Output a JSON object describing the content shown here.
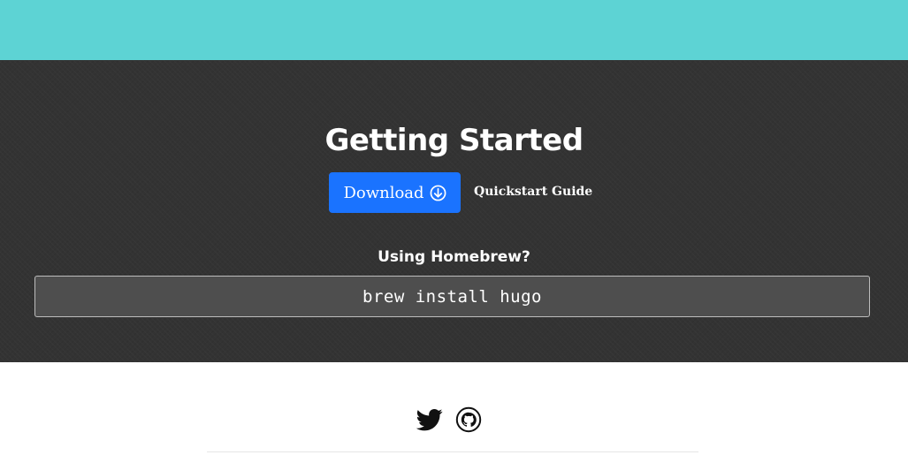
{
  "colors": {
    "top_band": "#5dd3d4",
    "dark_section": "#333333",
    "download_button": "#1a73ff",
    "code_box": "#4e4e4e"
  },
  "hero": {
    "title": "Getting Started",
    "download_button": {
      "label": "Download",
      "icon": "arrow-down-circle-icon"
    },
    "quickstart_link": "Quickstart Guide"
  },
  "homebrew": {
    "label": "Using Homebrew?",
    "command": "brew install hugo"
  },
  "footer": {
    "social_icons": [
      "twitter-icon",
      "github-icon"
    ]
  }
}
